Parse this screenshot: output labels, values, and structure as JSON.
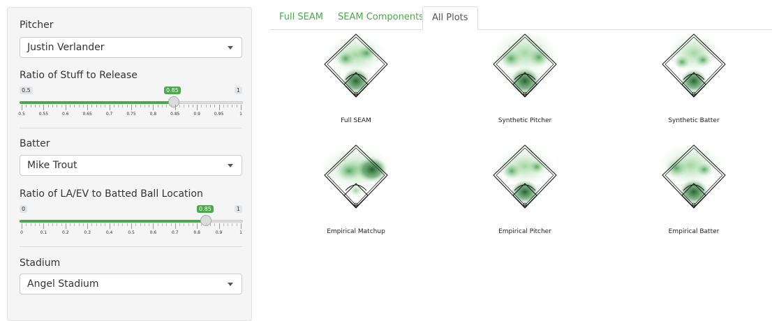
{
  "sidebar": {
    "pitcher": {
      "label": "Pitcher",
      "selected": "Justin Verlander"
    },
    "stuff_slider": {
      "label": "Ratio of Stuff to Release",
      "min": "0.5",
      "max": "1",
      "value": "0.85",
      "ticks": [
        "0.5",
        "0.55",
        "0.6",
        "0.65",
        "0.7",
        "0.75",
        "0.8",
        "0.85",
        "0.9",
        "0.95",
        "1"
      ]
    },
    "batter": {
      "label": "Batter",
      "selected": "Mike Trout"
    },
    "laev_slider": {
      "label": "Ratio of LA/EV to Batted Ball Location",
      "min": "0",
      "max": "1",
      "value": "0.85",
      "ticks": [
        "0",
        "0.1",
        "0.2",
        "0.3",
        "0.4",
        "0.5",
        "0.6",
        "0.7",
        "0.8",
        "0.9",
        "1"
      ]
    },
    "stadium": {
      "label": "Stadium",
      "selected": "Angel Stadium"
    }
  },
  "tabs": [
    "Full SEAM",
    "SEAM Components",
    "All Plots"
  ],
  "active_tab": "All Plots",
  "plots": [
    "Full SEAM",
    "Synthetic Pitcher",
    "Synthetic Batter",
    "Empirical Matchup",
    "Empirical Pitcher",
    "Empirical Batter"
  ],
  "colors": {
    "accent": "#4ca84c",
    "heat_dark": "#1d5a28",
    "heat_light": "#c9e8c9"
  }
}
